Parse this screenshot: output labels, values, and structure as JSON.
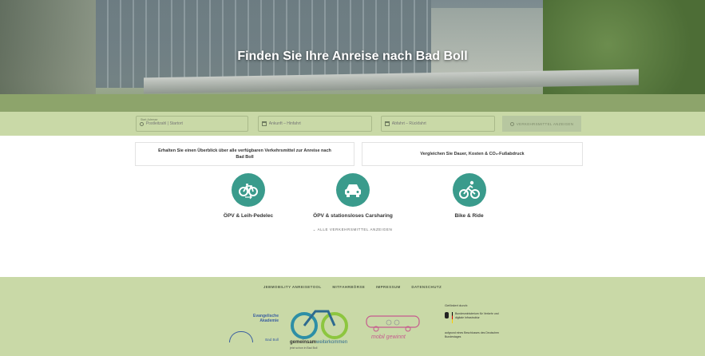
{
  "hero": {
    "title": "Finden Sie Ihre Anreise nach Bad Boll"
  },
  "search": {
    "start_label": "Start-Adresse",
    "start_placeholder": "Postleitzahl | Startort",
    "arrival_placeholder": "Ankunft – Hinfahrt",
    "departure_placeholder": "Abfahrt – Rückfahrt",
    "button_label": "VERKEHRSMITTEL ANZEIGEN"
  },
  "info": {
    "left": "Erhalten Sie einen Überblick über alle verfügbaren Verkehrsmittel zur Anreise nach Bad Boll",
    "right": "Vergleichen Sie Dauer, Kosten & CO₂-Fußabdruck"
  },
  "modes": [
    {
      "label": "ÖPV & Leih-Pedelec",
      "icon": "bicycle-icon"
    },
    {
      "label": "ÖPV & stationsloses Carsharing",
      "icon": "car-icon"
    },
    {
      "label": "Bike & Ride",
      "icon": "cyclist-icon"
    }
  ],
  "all_link": "ALLE VERKEHRSMITTEL ANZEIGEN",
  "footer": {
    "nav": [
      "JEBMOBILITY ANREISETOOL",
      "MITFAHRBÖRSE",
      "IMPRESSUM",
      "DATENSCHUTZ"
    ],
    "logo_ea_line1": "Evangelische",
    "logo_ea_line2": "Akademie",
    "logo_ea_line3": "Bad Boll",
    "logo_gw_bold": "gemeinsam",
    "logo_gw_rest": "weiterkommen",
    "logo_gw_sub": "jetzt schon in Bad Boll",
    "logo_mg": "mobil gewinnt",
    "funder_heading": "Gefördert durch:",
    "funder_ministry": "Bundesministerium für Verkehr und digitale Infrastruktur",
    "funder_note": "aufgrund eines Beschlusses des Deutschen Bundestages"
  },
  "colors": {
    "accent": "#3a9b8c",
    "bar": "#c9d9a7"
  }
}
